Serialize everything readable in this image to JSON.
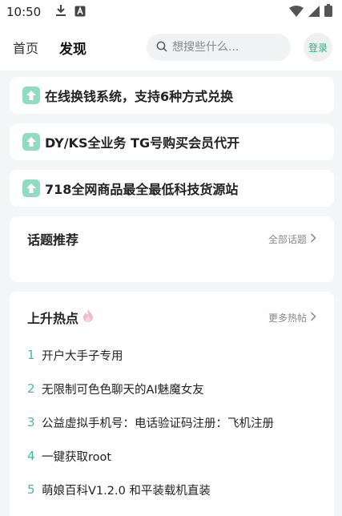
{
  "status_bar": {
    "time": "10:50"
  },
  "nav": {
    "tabs": [
      {
        "label": "首页",
        "active": false
      },
      {
        "label": "发现",
        "active": true
      }
    ],
    "search_placeholder": "想搜些什么...",
    "login_label": "登录"
  },
  "notices": [
    {
      "text": "在线换钱系统，支持6种方式兑换"
    },
    {
      "text": "DY/KS全业务 TG号购买会员代开"
    },
    {
      "text": "718全网商品最全最低科技货源站"
    }
  ],
  "topics": {
    "title": "话题推荐",
    "more_label": "全部话题"
  },
  "hot": {
    "title": "上升热点",
    "more_label": "更多热帖",
    "items": [
      {
        "rank": "1",
        "text": "开户大手子专用"
      },
      {
        "rank": "2",
        "text": "无限制可色色聊天的AI魅魔女友"
      },
      {
        "rank": "3",
        "text": "公益虚拟手机号：电话验证码注册：飞机注册"
      },
      {
        "rank": "4",
        "text": "一键获取root"
      },
      {
        "rank": "5",
        "text": "萌娘百科V1.2.0 和平装载机直装"
      }
    ]
  },
  "colors": {
    "accent": "#3fbf8f",
    "notice_icon": "#8fdcc0",
    "login_text": "#2bb57f"
  }
}
